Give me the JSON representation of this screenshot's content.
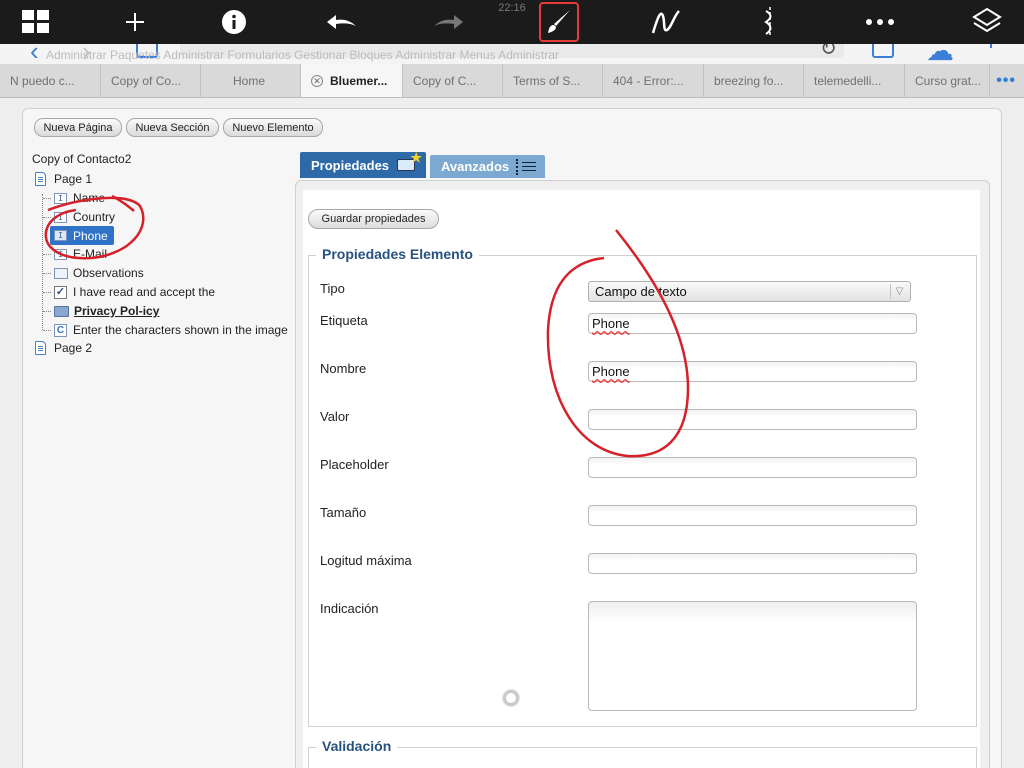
{
  "annotation_toolbar": {
    "status_time": "22:16",
    "tools": [
      {
        "icon": "grid-icon"
      },
      {
        "icon": "plus-icon"
      },
      {
        "icon": "info-icon"
      },
      {
        "icon": "undo-icon"
      },
      {
        "icon": "redo-icon"
      },
      {
        "icon": "brush-icon",
        "active": true
      },
      {
        "icon": "pen-icon"
      },
      {
        "icon": "split-icon"
      },
      {
        "icon": "more-icon"
      },
      {
        "icon": "layers-icon"
      }
    ],
    "active_color": "#e23b3b"
  },
  "browser": {
    "url_fragment": "bluemerma",
    "bookmarks_ghost": "Administrar Paquetes    Administrar Formularios    Gestionar Bloques    Administrar Menus    Administrar"
  },
  "tabs": [
    {
      "label": "N puedo c..."
    },
    {
      "label": "Copy of Co..."
    },
    {
      "label": "Home"
    },
    {
      "label": "Bluemer...",
      "active": true
    },
    {
      "label": "Copy of C..."
    },
    {
      "label": "Terms of S..."
    },
    {
      "label": "404 - Error:..."
    },
    {
      "label": "breezing fo..."
    },
    {
      "label": "telemedelli..."
    },
    {
      "label": "Curso grat..."
    }
  ],
  "toolbar": {
    "new_page": "Nueva Página",
    "new_section": "Nueva Sección",
    "new_element": "Nuevo Elemento"
  },
  "tree": {
    "root": "Copy of Contacto2",
    "page1": "Page 1",
    "items": [
      {
        "label": "Name",
        "icon": "textfield-icon"
      },
      {
        "label": "Country",
        "icon": "textfield-icon"
      },
      {
        "label": "Phone",
        "icon": "textfield-icon",
        "selected": true
      },
      {
        "label": "E-Mail",
        "icon": "textfield-icon"
      },
      {
        "label": "Observations",
        "icon": "textarea-icon"
      },
      {
        "label": "I have read and accept the",
        "icon": "checkbox-icon"
      },
      {
        "label": "Privacy Pol-icy",
        "icon": "folder-icon"
      },
      {
        "label": "Enter the characters shown in the image",
        "icon": "captcha-icon"
      }
    ],
    "page2": "Page 2",
    "selected_color": "#2f73c8"
  },
  "properties": {
    "tab_properties": "Propiedades",
    "tab_advanced": "Avanzados",
    "save_button": "Guardar propiedades",
    "section_title": "Propiedades Elemento",
    "fields": {
      "tipo_label": "Tipo",
      "tipo_value": "Campo de texto",
      "etiqueta_label": "Etiqueta",
      "etiqueta_value": "Phone",
      "nombre_label": "Nombre",
      "nombre_value": "Phone",
      "valor_label": "Valor",
      "placeholder_label": "Placeholder",
      "tamano_label": "Tamaño",
      "longitud_label": "Logitud máxima",
      "indicacion_label": "Indicación"
    },
    "validation_title": "Validación"
  }
}
